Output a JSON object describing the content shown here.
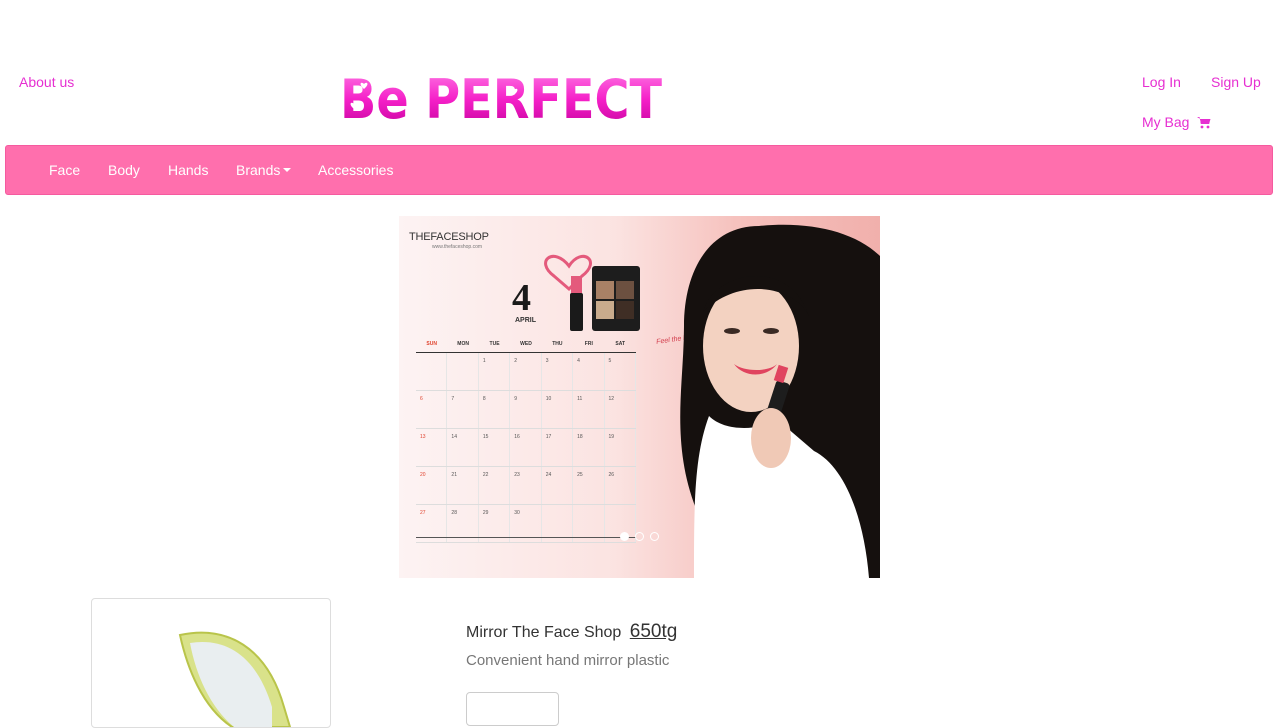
{
  "header": {
    "about_us": "About us",
    "logo_text": "Be PERFECT",
    "login": "Log In",
    "signup": "Sign Up",
    "my_bag": "My Bag"
  },
  "nav": {
    "items": [
      "Face",
      "Body",
      "Hands",
      "Brands",
      "Accessories"
    ]
  },
  "carousel": {
    "brand": "THEFACESHOP",
    "brand_url": "www.thefaceshop.com",
    "day": "4",
    "month": "APRIL",
    "weekdays": [
      "SUN",
      "MON",
      "TUE",
      "WED",
      "THU",
      "FRI",
      "SAT"
    ],
    "weeks": [
      [
        "",
        "",
        "1",
        "2",
        "3",
        "4",
        "5"
      ],
      [
        "6",
        "7",
        "8",
        "9",
        "10",
        "11",
        "12"
      ],
      [
        "13",
        "14",
        "15",
        "16",
        "17",
        "18",
        "19"
      ],
      [
        "20",
        "21",
        "22",
        "23",
        "24",
        "25",
        "26"
      ],
      [
        "27",
        "28",
        "29",
        "30",
        "",
        "",
        ""
      ]
    ],
    "handwriting": "Feel the bright beauty!",
    "slides": 3,
    "active_slide": 1
  },
  "product": {
    "title": "Mirror The Face Shop",
    "price": "650tg",
    "description": "Convenient hand mirror plastic"
  },
  "colors": {
    "accent": "#ff6fad",
    "link": "#e62fd1",
    "logo": "#f520c8"
  }
}
